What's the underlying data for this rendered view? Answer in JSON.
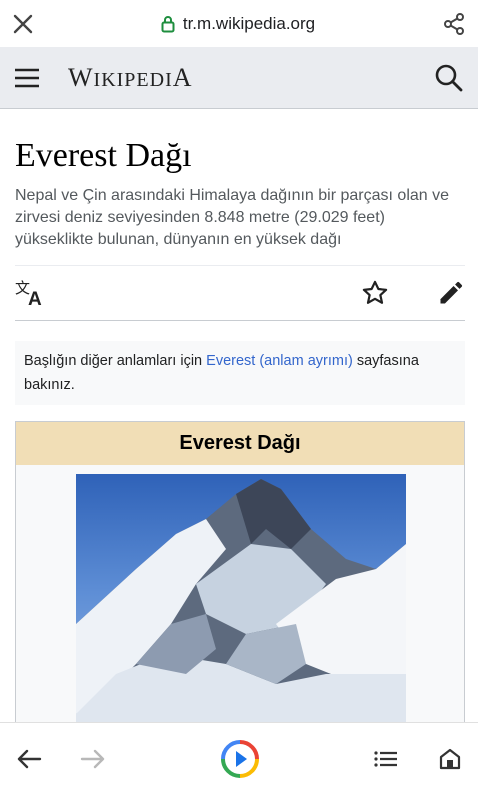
{
  "browser": {
    "url": "tr.m.wikipedia.org",
    "close_icon": "close-icon",
    "lock_icon": "lock-icon",
    "share_icon": "share-icon"
  },
  "header": {
    "menu_icon": "menu-icon",
    "wordmark_first": "W",
    "wordmark_rest": "IKIPEDI",
    "wordmark_last": "A",
    "search_icon": "search-icon"
  },
  "article": {
    "title": "Everest Dağı",
    "description": "Nepal ve Çin arasındaki Himalaya dağının bir parçası olan ve zirvesi deniz seviyesinden 8.848 metre (29.029 feet) yükseklikte bulunan, dünyanın en yüksek dağı"
  },
  "actions": {
    "language_icon": "language-icon",
    "watch_icon": "star-icon",
    "edit_icon": "pencil-icon"
  },
  "hatnote": {
    "before": "Başlığın diğer anlamları için ",
    "link": "Everest (anlam ayrımı)",
    "after": " sayfasına bakınız."
  },
  "infobox": {
    "title": "Everest Dağı"
  },
  "bottom_nav": {
    "back_icon": "arrow-left-icon",
    "forward_icon": "arrow-right-icon",
    "play_icon": "play-icon",
    "list_icon": "list-icon",
    "home_icon": "home-icon"
  },
  "colors": {
    "link": "#3366cc",
    "header_bg": "#eaecf0",
    "infobox_title_bg": "#f1deb6"
  }
}
